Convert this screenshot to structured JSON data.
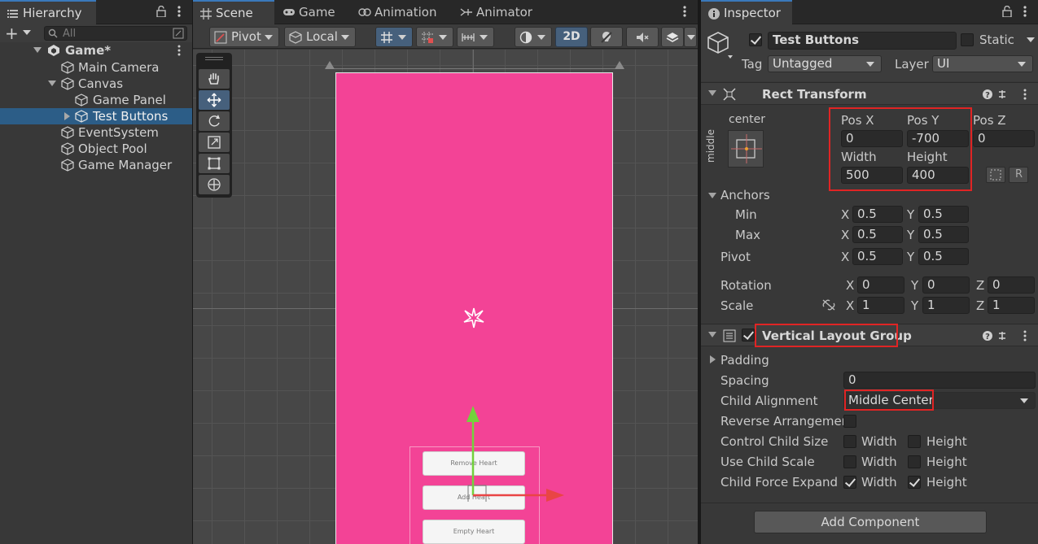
{
  "hierarchy": {
    "tab_label": "Hierarchy",
    "search_placeholder": "All",
    "items": [
      {
        "label": "Game*",
        "depth": 0,
        "expanded": true,
        "bold": true
      },
      {
        "label": "Main Camera",
        "depth": 1
      },
      {
        "label": "Canvas",
        "depth": 1,
        "expanded": true
      },
      {
        "label": "Game Panel",
        "depth": 2
      },
      {
        "label": "Test Buttons",
        "depth": 2,
        "selected": true,
        "collapsed": true
      },
      {
        "label": "EventSystem",
        "depth": 1
      },
      {
        "label": "Object Pool",
        "depth": 1
      },
      {
        "label": "Game Manager",
        "depth": 1
      }
    ]
  },
  "scene": {
    "tabs": [
      "Scene",
      "Game",
      "Animation",
      "Animator"
    ],
    "active_tab": "Scene",
    "toolbar": {
      "pivot_label": "Pivot",
      "local_label": "Local",
      "mode_2d_label": "2D"
    },
    "buttons": [
      "Remove Heart",
      "Add Heart",
      "Empty Heart"
    ],
    "canvas_color": "#f34396"
  },
  "inspector": {
    "tab_label": "Inspector",
    "object_name": "Test Buttons",
    "active": true,
    "static_label": "Static",
    "tag_label": "Tag",
    "tag_value": "Untagged",
    "layer_label": "Layer",
    "layer_value": "UI",
    "rect_transform": {
      "title": "Rect Transform",
      "anchor_preset_h": "center",
      "anchor_preset_v": "middle",
      "pos_x_label": "Pos X",
      "pos_x": "0",
      "pos_y_label": "Pos Y",
      "pos_y": "-700",
      "pos_z_label": "Pos Z",
      "pos_z": "0",
      "width_label": "Width",
      "width": "500",
      "height_label": "Height",
      "height": "400",
      "anchors_label": "Anchors",
      "min_label": "Min",
      "min_x": "0.5",
      "min_y": "0.5",
      "max_label": "Max",
      "max_x": "0.5",
      "max_y": "0.5",
      "pivot_label": "Pivot",
      "pivot_x": "0.5",
      "pivot_y": "0.5",
      "rotation_label": "Rotation",
      "rot_x": "0",
      "rot_y": "0",
      "rot_z": "0",
      "scale_label": "Scale",
      "scale_x": "1",
      "scale_y": "1",
      "scale_z": "1",
      "axis_x": "X",
      "axis_y": "Y",
      "axis_z": "Z"
    },
    "vertical_layout_group": {
      "title": "Vertical Layout Group",
      "enabled": true,
      "padding_label": "Padding",
      "spacing_label": "Spacing",
      "spacing": "0",
      "child_alignment_label": "Child Alignment",
      "child_alignment": "Middle Center",
      "reverse_label": "Reverse Arrangemen",
      "control_child_size_label": "Control Child Size",
      "use_child_scale_label": "Use Child Scale",
      "child_force_expand_label": "Child Force Expand",
      "width_label": "Width",
      "height_label": "Height"
    },
    "add_component_label": "Add Component"
  },
  "colors": {
    "accent": "#3a79bb",
    "selection": "#2c5d87",
    "highlight": "#e02424"
  }
}
